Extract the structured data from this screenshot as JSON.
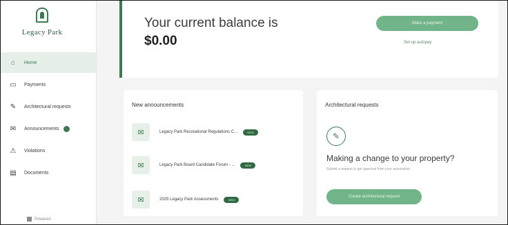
{
  "sidebar": {
    "logo_text": "Legacy Park",
    "items": [
      {
        "label": "Home",
        "icon": "home-icon",
        "glyph": "⌂",
        "active": true
      },
      {
        "label": "Payments",
        "icon": "card-icon",
        "glyph": "▭"
      },
      {
        "label": "Architectural requests",
        "icon": "wrench-icon",
        "glyph": "✎"
      },
      {
        "label": "Announcements",
        "icon": "megaphone-icon",
        "glyph": "✉",
        "badge": true
      },
      {
        "label": "Violations",
        "icon": "warning-icon",
        "glyph": "⚠"
      },
      {
        "label": "Documents",
        "icon": "document-icon",
        "glyph": "▤"
      }
    ],
    "footer_text": "Powered"
  },
  "balance": {
    "label": "Your current balance is",
    "amount": "$0.00",
    "pay_button": "Make a payment",
    "autopay_link": "Set up autopay"
  },
  "announcements": {
    "title": "New announcements",
    "items": [
      {
        "text": "Legacy Park Recreational Regulations C...",
        "badge": "NEW"
      },
      {
        "text": "Legacy Park Board Candidate Forum - ...",
        "badge": "NEW"
      },
      {
        "text": "2025 Legacy Park Assessments",
        "badge": "NEW"
      }
    ]
  },
  "architectural": {
    "title": "Architectural requests",
    "heading": "Making a change to your property?",
    "subtext": "Submit a request to get approval from your association",
    "button": "Create architectural request"
  },
  "colors": {
    "brand_green": "#3d7a54",
    "button_green": "#71b489",
    "active_bg": "#e6efe8"
  }
}
